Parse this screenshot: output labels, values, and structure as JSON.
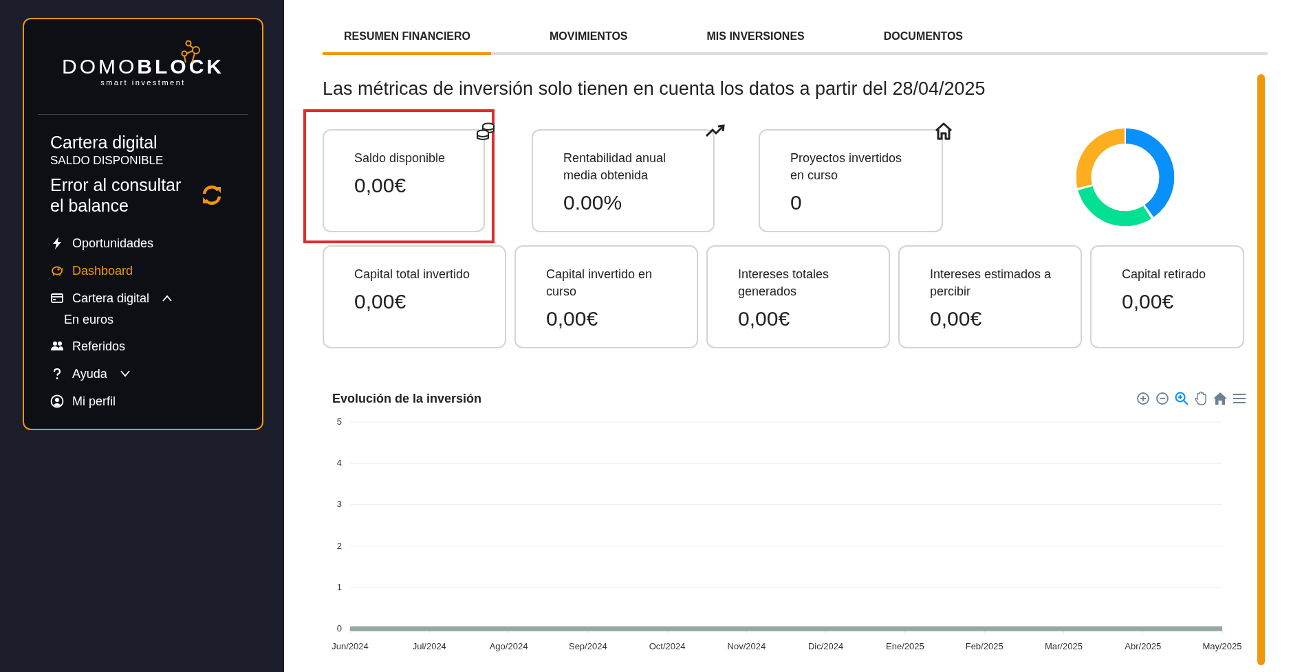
{
  "sidebar": {
    "logo": {
      "wordmark": "DOMO**BLOCK**",
      "tagline": "smart investment"
    },
    "wallet": {
      "title": "Cartera digital",
      "subtitle": "SALDO DISPONIBLE",
      "balance_message": "Error al consultar el balance"
    },
    "nav": [
      {
        "label": "Oportunidades",
        "selected": false
      },
      {
        "label": "Dashboard",
        "selected": true
      },
      {
        "label": "Cartera digital",
        "selected": false,
        "expanded": true,
        "children": [
          {
            "label": "En euros"
          }
        ]
      },
      {
        "label": "Referidos",
        "selected": false
      },
      {
        "label": "Ayuda",
        "selected": false,
        "expanded": false
      },
      {
        "label": "Mi perfil",
        "selected": false
      }
    ]
  },
  "tabs": [
    {
      "label": "RESUMEN FINANCIERO",
      "selected": true
    },
    {
      "label": "MOVIMIENTOS",
      "selected": false
    },
    {
      "label": "MIS INVERSIONES",
      "selected": false
    },
    {
      "label": "DOCUMENTOS",
      "selected": false
    }
  ],
  "notice": "Las métricas de inversión solo tienen en cuenta los datos a partir del 28/04/2025",
  "metrics_top": [
    {
      "label": "Saldo disponible",
      "value": "0,00€",
      "highlighted": true
    },
    {
      "label": "Rentabilidad anual media obtenida",
      "value": "0.00%",
      "highlighted": false
    },
    {
      "label": "Proyectos invertidos en curso",
      "value": "0",
      "highlighted": false
    }
  ],
  "metrics_bottom": [
    {
      "label": "Capital total invertido",
      "value": "0,00€"
    },
    {
      "label": "Capital invertido en curso",
      "value": "0,00€"
    },
    {
      "label": "Intereses totales generados",
      "value": "0,00€"
    },
    {
      "label": "Intereses estimados a percibir",
      "value": "0,00€"
    },
    {
      "label": "Capital retirado",
      "value": "0,00€"
    }
  ],
  "chart": {
    "toolbar": [
      {
        "selected": false
      },
      {
        "selected": false
      },
      {
        "selected": true
      },
      {
        "selected": false
      },
      {
        "selected": false
      },
      {
        "selected": false
      }
    ],
    "chart_data": {
      "type": "line",
      "title": "Evolución de la inversión",
      "categories": [
        "Jun/2024",
        "Jul/2024",
        "Ago/2024",
        "Sep/2024",
        "Oct/2024",
        "Nov/2024",
        "Dic/2024",
        "Ene/2025",
        "Feb/2025",
        "Mar/2025",
        "Abr/2025",
        "May/2025"
      ],
      "series": [
        {
          "color": "#95a7a0",
          "values": [
            0,
            0,
            0,
            0,
            0,
            0,
            0,
            0,
            0,
            0,
            0,
            0
          ]
        }
      ],
      "ylim": [
        0,
        5
      ],
      "yticks": [
        0,
        1,
        2,
        3,
        4,
        5
      ],
      "grid": true
    }
  }
}
